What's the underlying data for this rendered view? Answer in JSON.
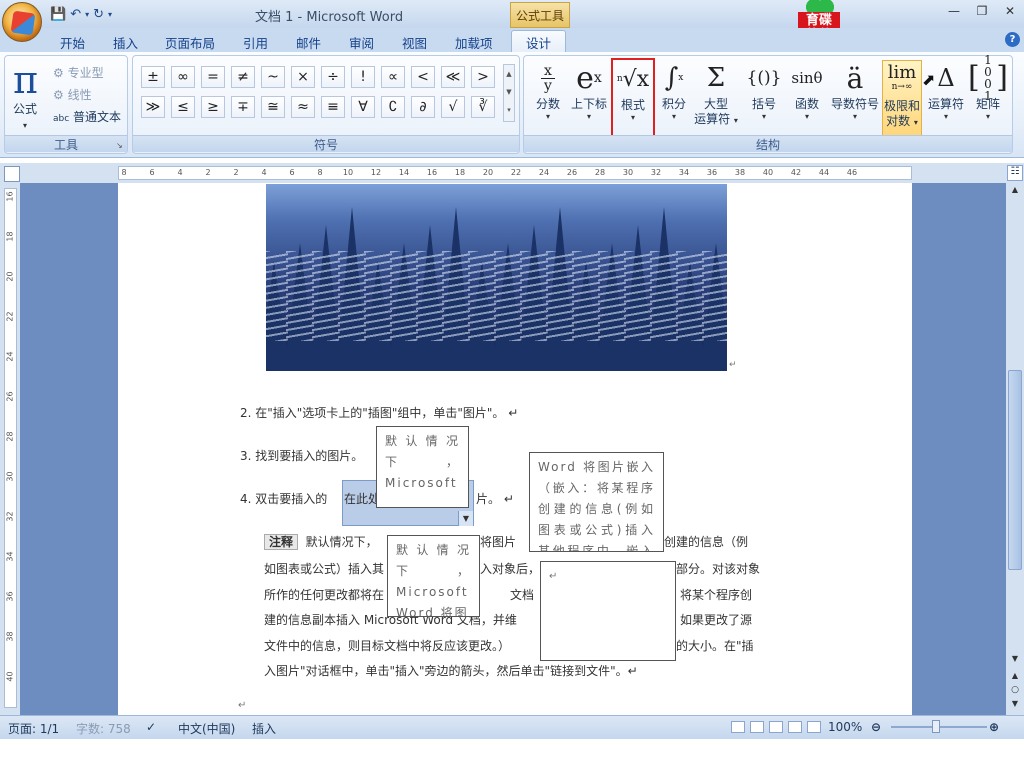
{
  "window": {
    "title": "文档 1 - Microsoft Word",
    "context_tools": "公式工具",
    "brand_logo": "育碟软件"
  },
  "quick_access": [
    "save-icon",
    "undo-icon",
    "redo-icon",
    "customize-icon"
  ],
  "tabs": [
    "开始",
    "插入",
    "页面布局",
    "引用",
    "邮件",
    "审阅",
    "视图",
    "加载项",
    "设计"
  ],
  "active_tab": "设计",
  "ribbon": {
    "tools": {
      "formula_label": "公式",
      "professional": "专业型",
      "linear": "线性",
      "plain_text": "普通文本",
      "group_label": "工具"
    },
    "symbols": {
      "row1": [
        "±",
        "∞",
        "=",
        "≠",
        "~",
        "×",
        "÷",
        "!",
        "∝",
        "<",
        "≪",
        ">"
      ],
      "row2": [
        "≫",
        "≤",
        "≥",
        "∓",
        "≅",
        "≈",
        "≡",
        "∀",
        "∁",
        "∂",
        "√",
        "∛"
      ],
      "group_label": "符号"
    },
    "structures": {
      "items": [
        {
          "icon": "x/y",
          "label": "分数"
        },
        {
          "icon": "eˣ",
          "label": "上下标"
        },
        {
          "icon": "ⁿ√x",
          "label": "根式"
        },
        {
          "icon": "∫",
          "label": "积分"
        },
        {
          "icon": "Σ",
          "label": "大型",
          "label2": "运算符"
        },
        {
          "icon": "{()}",
          "label": "括号"
        },
        {
          "icon": "sinθ",
          "label": "函数"
        },
        {
          "icon": "ä",
          "label": "导数符号"
        },
        {
          "icon": "lim",
          "label": "极限和",
          "label2": "对数"
        },
        {
          "icon": "Δ",
          "label": "运算符"
        },
        {
          "icon": "[10 01]",
          "label": "矩阵"
        }
      ],
      "group_label": "结构"
    }
  },
  "ruler": {
    "numbers": [
      "8",
      "6",
      "4",
      "2",
      "2",
      "4",
      "6",
      "8",
      "10",
      "12",
      "14",
      "16",
      "18",
      "20",
      "22",
      "24",
      "26",
      "28",
      "30",
      "32",
      "34",
      "36",
      "38",
      "40",
      "42",
      "44",
      "46"
    ]
  },
  "vruler": {
    "numbers": [
      "16",
      "18",
      "20",
      "22",
      "24",
      "26",
      "28",
      "30",
      "32",
      "34",
      "36",
      "38",
      "40"
    ]
  },
  "document": {
    "step2": "2.   在\"插入\"选项卡上的\"插图\"组中，单击\"图片\"。   ↵",
    "step3": "3.   找到要插入的图片。",
    "step4_pre": "4.   双击要插入的",
    "step4_sel": "在此处",
    "step4_post": "片。  ↵",
    "note_label": "注释",
    "note_line1": "默认情况下，",
    "note_line1b": "将图片",
    "note_line1c": "创建的信息（例",
    "note_line2": "如图表或公式）插入其",
    "note_line2b": "入对象后，",
    "note_line2c": "部分。对该对象",
    "note_line3": "所作的任何更改都将在",
    "note_line3b": "文档",
    "note_line3c": "将某个程序创",
    "note_line4": "建的信息副本插入 Microsoft Word 文档，并维",
    "note_line4b": "如果更改了源",
    "note_line5": "文件中的信息，则目标文档中将反应该更改。）",
    "note_line5b": "的大小。在\"插",
    "note_line6": "入图片\"对话框中，单击\"插入\"旁边的箭头，然后单击\"链接到文件\"。↵",
    "para_mark": "↵",
    "textbox1": "默认情况下，Microsoft",
    "textbox2": "Word 将图片嵌入（嵌入：将某程序创建的信息(例如图表或公式)插入其他程序中。嵌入对象",
    "textbox3": "默认情况下，Microsoft Word 将图",
    "textbox4": "↵"
  },
  "status": {
    "page": "页面: 1/1",
    "words": "字数: 758",
    "language": "中文(中国)",
    "mode": "插入",
    "zoom": "100%"
  },
  "colors": {
    "ribbon_bg": "#e5eef9",
    "doc_bg": "#6d8cbf",
    "highlight_red": "#e0201f",
    "active_button": "#ffd67a"
  }
}
